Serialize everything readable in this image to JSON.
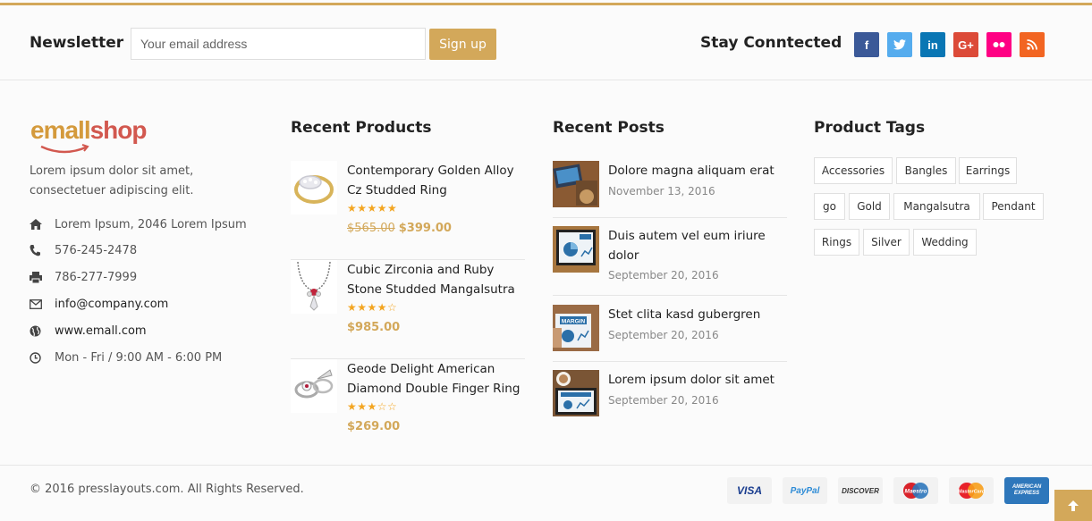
{
  "newsletter": {
    "title": "Newsletter",
    "email_placeholder": "Your email address",
    "signup_label": "Sign up"
  },
  "social": {
    "title": "Stay Conntected",
    "links": [
      {
        "name": "facebook",
        "glyph": "f",
        "color": "#3b5998"
      },
      {
        "name": "twitter",
        "glyph": "t",
        "color": "#55acee"
      },
      {
        "name": "linkedin",
        "glyph": "in",
        "color": "#0976b4"
      },
      {
        "name": "google-plus",
        "glyph": "G+",
        "color": "#dc4a38"
      },
      {
        "name": "flickr",
        "glyph": "••",
        "color": "#ff0084"
      },
      {
        "name": "rss",
        "glyph": "rss",
        "color": "#f26522"
      }
    ]
  },
  "about": {
    "logo_part1": "emall",
    "logo_part2": "shop",
    "text": "Lorem ipsum dolor sit amet, consectetuer adipiscing elit.",
    "address": "Lorem Ipsum, 2046 Lorem Ipsum",
    "phone": "576-245-2478",
    "fax": "786-277-7999",
    "email": "info@company.com",
    "website": "www.emall.com",
    "hours": "Mon - Fri / 9:00 AM - 6:00 PM"
  },
  "recent_products": {
    "title": "Recent Products",
    "items": [
      {
        "name": "Contemporary Golden Alloy Cz Studded Ring",
        "stars": "★★★★★",
        "old_price": "$565.00",
        "price": "$399.00",
        "rating": 5
      },
      {
        "name": "Cubic Zirconia and Ruby Stone Studded Mangalsutra",
        "stars": "★★★★☆",
        "old_price": "",
        "price": "$985.00",
        "rating": 4
      },
      {
        "name": "Geode Delight American Diamond Double Finger Ring",
        "stars": "★★★☆☆",
        "old_price": "",
        "price": "$269.00",
        "rating": 3
      }
    ]
  },
  "recent_posts": {
    "title": "Recent Posts",
    "items": [
      {
        "title": "Dolore magna aliquam erat",
        "date": "November 13, 2016"
      },
      {
        "title": "Duis autem vel eum iriure dolor",
        "date": "September 20, 2016"
      },
      {
        "title": "Stet clita kasd gubergren",
        "date": "September 20, 2016"
      },
      {
        "title": "Lorem ipsum dolor sit amet",
        "date": "September 20, 2016"
      }
    ]
  },
  "product_tags": {
    "title": "Product Tags",
    "tags": [
      "Accessories",
      "Bangles",
      "Earrings",
      "go",
      "Gold",
      "Mangalsutra",
      "Pendant",
      "Rings",
      "Silver",
      "Wedding"
    ]
  },
  "footer": {
    "copyright": "© 2016 presslayouts.com. All Rights Reserved.",
    "cards": [
      {
        "name": "visa",
        "label": "VISA",
        "color": "#1a3d8f"
      },
      {
        "name": "paypal",
        "label": "PayPal",
        "color": "#2c8bd6"
      },
      {
        "name": "discover",
        "label": "DISCOVER",
        "color": "#333333"
      },
      {
        "name": "maestro",
        "label": "Maestro",
        "color": "#d9222a"
      },
      {
        "name": "mastercard",
        "label": "MasterCard",
        "color": "#f79e1b"
      },
      {
        "name": "amex",
        "label": "AMERICAN EXPRESS",
        "color": "#2e77bb"
      }
    ]
  }
}
